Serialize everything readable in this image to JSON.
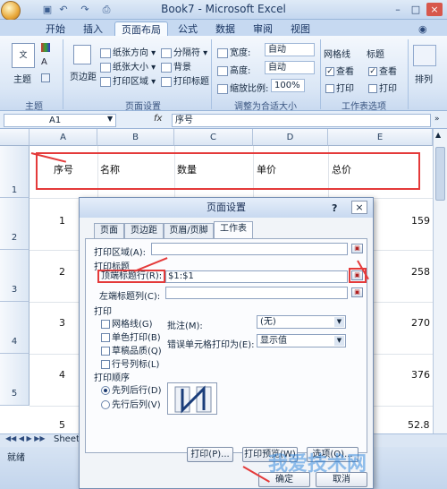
{
  "window": {
    "title": "Book7 - Microsoft Excel"
  },
  "tabs": [
    "开始",
    "插入",
    "页面布局",
    "公式",
    "数据",
    "审阅",
    "视图"
  ],
  "ribbon": {
    "theme_group": {
      "label": "主题",
      "button": "主题"
    },
    "page_setup_group": {
      "label": "页面设置",
      "margins": "页边距",
      "orientation": "纸张方向",
      "size": "纸张大小",
      "print_area": "打印区域",
      "breaks": "分隔符",
      "background": "背景",
      "print_titles": "打印标题"
    },
    "scale_group": {
      "label": "调整为合适大小",
      "width_label": "宽度:",
      "width_value": "自动",
      "height_label": "高度:",
      "height_value": "自动",
      "scale_label": "缩放比例:",
      "scale_value": "100%"
    },
    "sheet_options_group": {
      "label": "工作表选项",
      "gridlines": "网格线",
      "headings": "标题",
      "view": "查看",
      "print": "打印"
    },
    "arrange_group": {
      "label": "排列"
    }
  },
  "formula_bar": {
    "name_box": "A1",
    "fx": "fx",
    "content": "序号"
  },
  "sheet": {
    "columns": [
      "A",
      "B",
      "C",
      "D",
      "E"
    ],
    "rows": [
      "1",
      "2",
      "3",
      "4",
      "5"
    ],
    "header_row": [
      "序号",
      "名称",
      "数量",
      "单价",
      "总价"
    ],
    "col_a_values": [
      "1",
      "2",
      "3",
      "4",
      "5"
    ],
    "col_e_values": [
      "159",
      "258",
      "270",
      "376",
      "52.8"
    ],
    "sheet_tab": "Sheet",
    "status": "就绪"
  },
  "dialog": {
    "title": "页面设置",
    "help": "?",
    "close": "×",
    "tabs": [
      "页面",
      "页边距",
      "页眉/页脚",
      "工作表"
    ],
    "print_area_label": "打印区域(A):",
    "print_titles_heading": "打印标题",
    "rows_repeat_label": "顶端标题行(R):",
    "rows_repeat_value": "$1:$1",
    "cols_repeat_label": "左端标题列(C):",
    "print_heading": "打印",
    "gridlines": "网格线(G)",
    "black_white": "单色打印(B)",
    "draft": "草稿品质(Q)",
    "row_col_headings": "行号列标(L)",
    "comments_label": "批注(M):",
    "comments_value": "(无)",
    "errors_label": "错误单元格打印为(E):",
    "errors_value": "显示值",
    "page_order_heading": "打印顺序",
    "down_then_over": "先列后行(D)",
    "over_then_down": "先行后列(V)",
    "print_btn": "打印(P)...",
    "preview_btn": "打印预览(W)",
    "options_btn": "选项(O)...",
    "ok_btn": "确定",
    "cancel_btn": "取消"
  },
  "watermark": "我爱技术网"
}
